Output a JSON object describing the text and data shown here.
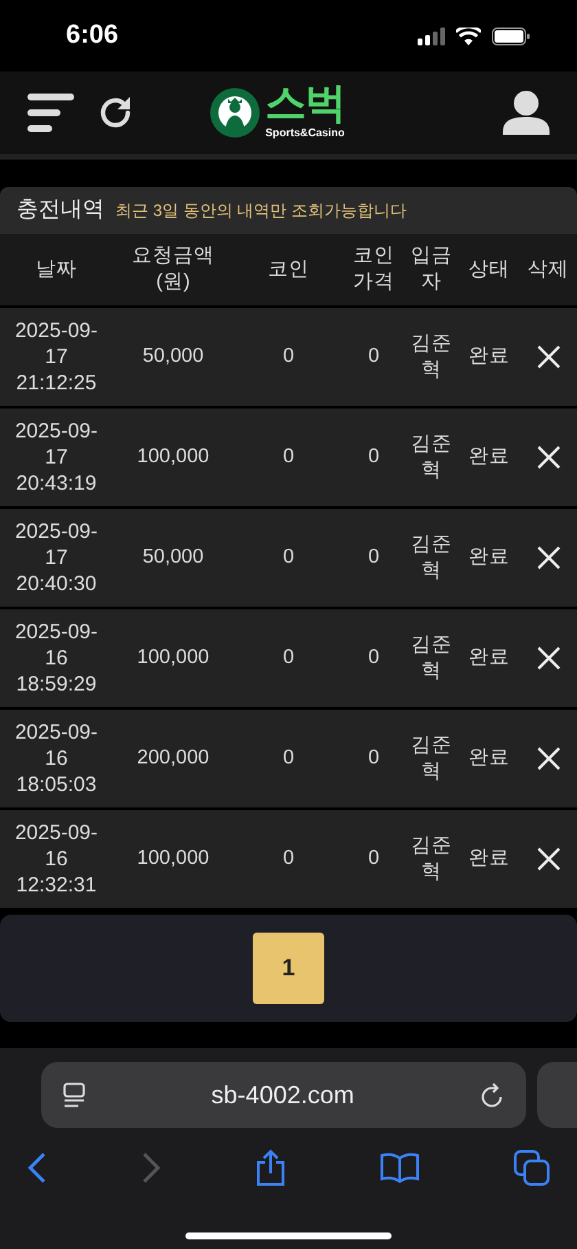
{
  "status_bar": {
    "time": "6:06"
  },
  "header": {
    "logo_text": "스벅",
    "logo_subtext": "Sports&Casino"
  },
  "panel": {
    "title": "충전내역",
    "notice": "최근 3일 동안의 내역만 조회가능합니다"
  },
  "table": {
    "columns": [
      "날짜",
      "요청금액 (원)",
      "코인",
      "코인 가격",
      "입금자",
      "상태",
      "삭제"
    ],
    "rows": [
      {
        "date": "2025-09-17 21:12:25",
        "amount": "50,000",
        "coin": "0",
        "coin_price": "0",
        "depositor": "김준혁",
        "status": "완료"
      },
      {
        "date": "2025-09-17 20:43:19",
        "amount": "100,000",
        "coin": "0",
        "coin_price": "0",
        "depositor": "김준혁",
        "status": "완료"
      },
      {
        "date": "2025-09-17 20:40:30",
        "amount": "50,000",
        "coin": "0",
        "coin_price": "0",
        "depositor": "김준혁",
        "status": "완료"
      },
      {
        "date": "2025-09-16 18:59:29",
        "amount": "100,000",
        "coin": "0",
        "coin_price": "0",
        "depositor": "김준혁",
        "status": "완료"
      },
      {
        "date": "2025-09-16 18:05:03",
        "amount": "200,000",
        "coin": "0",
        "coin_price": "0",
        "depositor": "김준혁",
        "status": "완료"
      },
      {
        "date": "2025-09-16 12:32:31",
        "amount": "100,000",
        "coin": "0",
        "coin_price": "0",
        "depositor": "김준혁",
        "status": "완료"
      }
    ]
  },
  "pagination": [
    {
      "label": "1",
      "selected": true
    }
  ],
  "browser": {
    "url": "sb-4002.com",
    "back_disabled": false,
    "forward_disabled": true
  }
}
